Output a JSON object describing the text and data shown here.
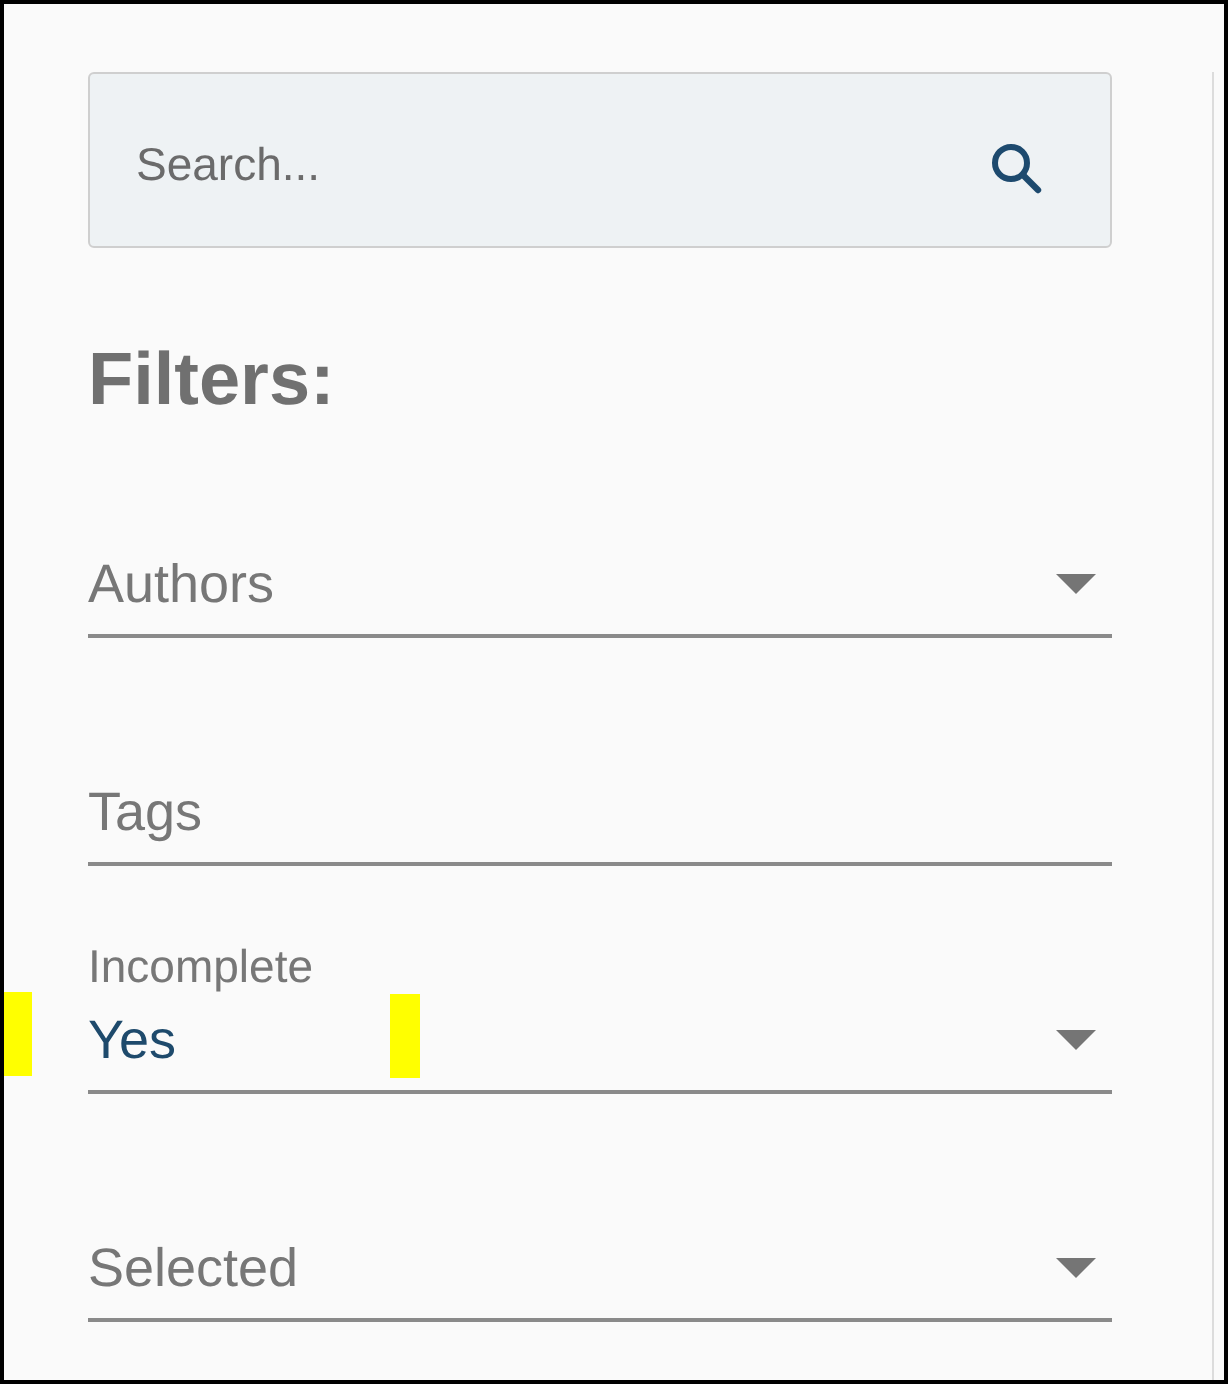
{
  "search": {
    "placeholder": "Search..."
  },
  "heading": "Filters:",
  "filters": [
    {
      "kind": "select",
      "label": "Authors"
    },
    {
      "kind": "text",
      "label": "Tags"
    },
    {
      "kind": "select",
      "label": "Incomplete",
      "value": "Yes"
    },
    {
      "kind": "select",
      "label": "Selected"
    }
  ]
}
